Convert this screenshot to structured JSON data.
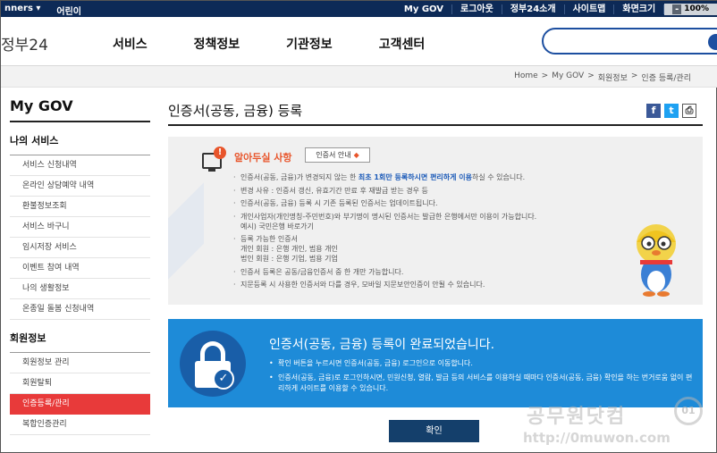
{
  "topbar": {
    "left_items": [
      "nners ▾",
      "어린이"
    ],
    "right_items": [
      "My GOV",
      "로그아웃",
      "정부24소개",
      "사이트맵",
      "화면크기"
    ],
    "zoom_value": "100%",
    "zoom_minus": "-"
  },
  "header": {
    "logo": "정부24",
    "nav": [
      "서비스",
      "정책정보",
      "기관정보",
      "고객센터"
    ]
  },
  "breadcrumb": [
    "Home",
    ">",
    "My GOV",
    ">",
    "회원정보",
    ">",
    "인증 등록/관리"
  ],
  "sidebar": {
    "title": "My GOV",
    "section1": "나의 서비스",
    "items1": [
      "서비스 신청내역",
      "온라인 상담예약 내역",
      "환불정보조회",
      "서비스 바구니",
      "임시저장 서비스",
      "이벤트 참여 내역",
      "나의 생활정보",
      "온종일 돌봄 신청내역"
    ],
    "section2": "회원정보",
    "items2": [
      "회원정보 관리",
      "회원탈퇴",
      "인증등록/관리",
      "복합인증관리"
    ]
  },
  "main": {
    "title": "인증서(공동, 금융) 등록",
    "share": {
      "facebook": "f",
      "twitter": "t",
      "print": "⎙"
    }
  },
  "notice": {
    "alert_icon": "!",
    "title": "알아두실 사항",
    "button": "인증서 안내",
    "button_arrow": "◆",
    "bullet1_a": "인증서(공동, 금융)가 변경되지 않는 한 ",
    "bullet1_hl": "최초 1회만 등록하시면 편리하게 이용",
    "bullet1_b": "하실 수 있습니다.",
    "lines": [
      "변경 사유 : 인증서 갱신, 유효기간 만료 후 재발급 받는 경우 등",
      "인증서(공동, 금융) 등록 시 기존 등록된 인증서는 업데이트됩니다.",
      "개인사업자(개인명칭-주민번호)와 부기명이 명시된 인증서는 발급한 은행에서만 이용이 가능합니다.\n예시) 국민은행 바로가기",
      "등록 가능한 인증서\n개인 회원 : 은행 개인, 범용 개인\n법인 회원 : 은행 기업, 범용 기업",
      "인증서 등록은 공동/금융인증서 중 한 개만 가능합니다.",
      "지문등록 시 사용한 인증서와 다를 경우, 모바일 지문보안인증이 안될 수 있습니다."
    ]
  },
  "complete": {
    "title": "인증서(공동, 금융) 등록이 완료되었습니다.",
    "check_icon": "✓",
    "items": [
      "확인 버튼을 누르시면 인증서(공동, 금융) 로그인으로 이동합니다.",
      "인증서(공동, 금융)로 로그인하시면, 민원신청, 열람, 발급 등의 서비스를 이용하실 때마다 인증서(공동, 금융) 확인을 하는 번거로움 없이 편리하게 사이트를 이용할 수 있습니다."
    ]
  },
  "confirm_button": "확인",
  "watermark": {
    "line1": "공무원닷컴",
    "line2": "http://0muwon.com",
    "badge": "01"
  }
}
